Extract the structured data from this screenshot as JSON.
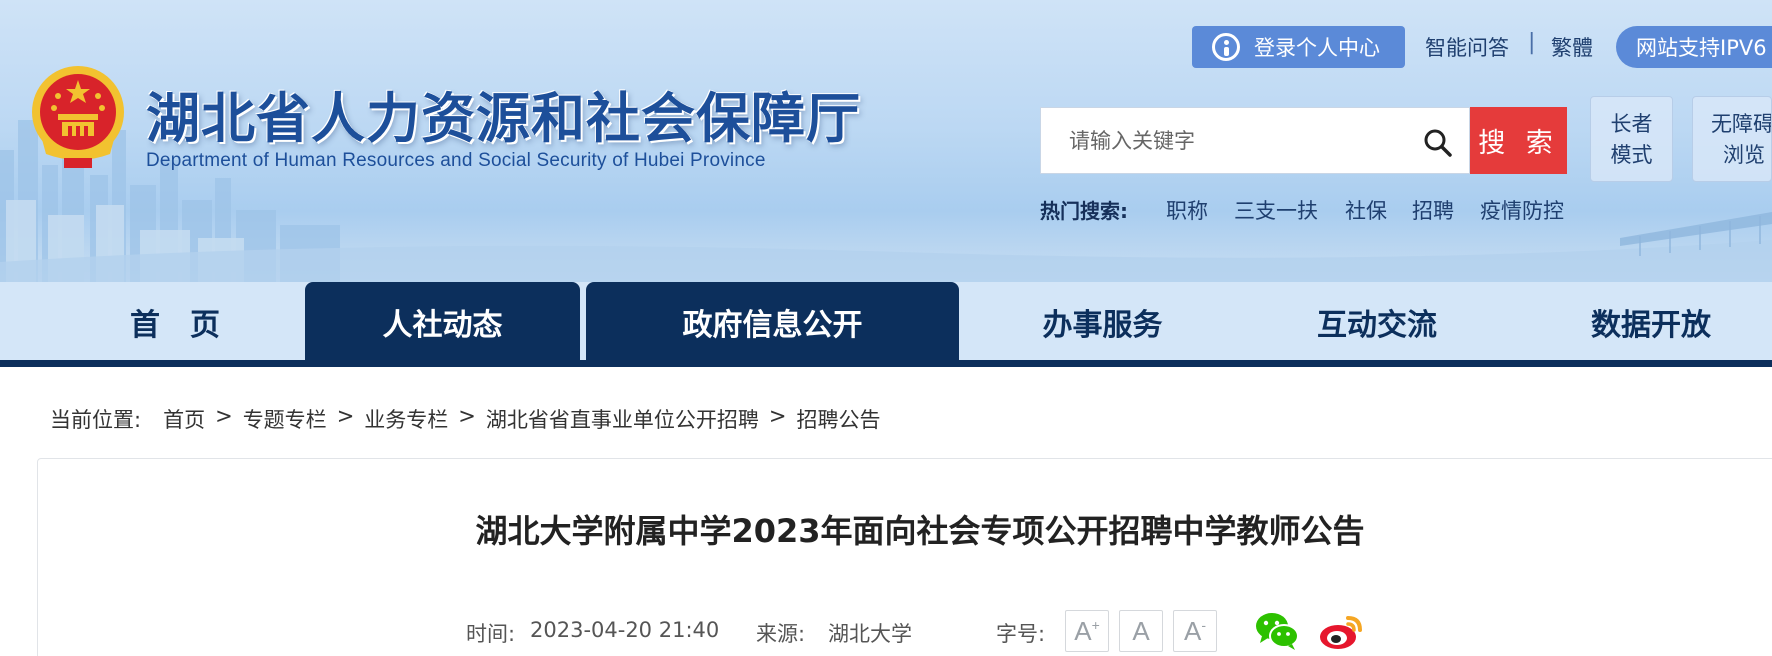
{
  "header": {
    "site_title": "湖北省人力资源和社会保障厅",
    "site_subtitle": "Department of Human Resources and Social Security of Hubei Province",
    "login_label": "登录个人中心",
    "qa_label": "智能问答",
    "separator": "|",
    "traditional_label": "繁體",
    "ipv6_label": "网站支持IPV6",
    "search": {
      "placeholder": "请输入关键字",
      "button_label": "搜 索"
    },
    "elder_mode": {
      "line1": "长者",
      "line2": "模式"
    },
    "accessible": {
      "line1": "无障碍",
      "line2": "浏览"
    },
    "hot_label": "热门搜索:",
    "hot_items": [
      "职称",
      "三支一扶",
      "社保",
      "招聘",
      "疫情防控"
    ]
  },
  "nav": {
    "items": [
      "首　页",
      "人社动态",
      "政府信息公开",
      "办事服务",
      "互动交流",
      "数据开放"
    ]
  },
  "breadcrumb": {
    "label": "当前位置:",
    "items": [
      "首页",
      "专题专栏",
      "业务专栏",
      "湖北省省直事业单位公开招聘",
      "招聘公告"
    ],
    "separator": ">"
  },
  "article": {
    "title": "湖北大学附属中学2023年面向社会专项公开招聘中学教师公告",
    "time_label": "时间:",
    "time_value": "2023-04-20 21:40",
    "source_label": "来源:",
    "source_value": "湖北大学",
    "font_size_label": "字号:",
    "font_buttons": [
      "A",
      "A",
      "A"
    ],
    "font_marks": [
      "+",
      "",
      "-"
    ]
  },
  "colors": {
    "brand_navy": "#0c2f5c",
    "title_blue": "#1d4f9a",
    "search_red": "#e53b3b",
    "button_blue": "#5b8ad8",
    "wechat_green": "#2dc100",
    "weibo_orange": "#f5a623"
  }
}
